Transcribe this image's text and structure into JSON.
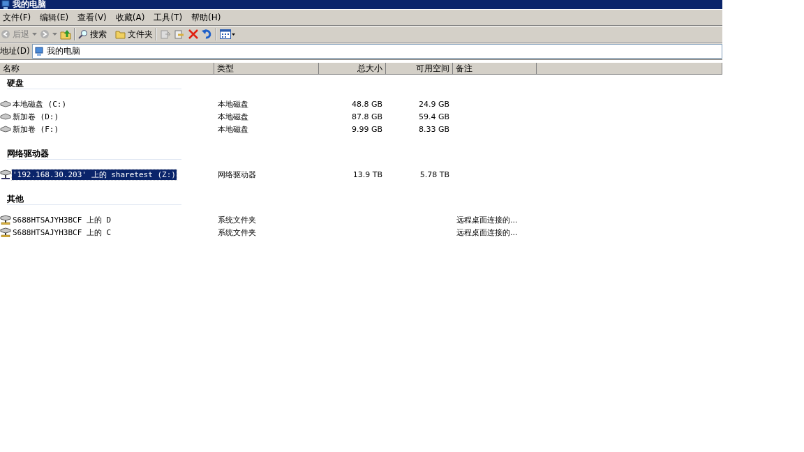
{
  "window": {
    "title": "我的电脑"
  },
  "menu": [
    "文件(F)",
    "编辑(E)",
    "查看(V)",
    "收藏(A)",
    "工具(T)",
    "帮助(H)"
  ],
  "toolbar": {
    "back": {
      "label": "后退",
      "disabled": true
    },
    "forward": {
      "disabled": true
    },
    "search": "搜索",
    "folders": "文件夹"
  },
  "address": {
    "label": "地址(D)",
    "value": "我的电脑"
  },
  "columns": [
    "名称",
    "类型",
    "总大小",
    "可用空间",
    "备注"
  ],
  "groups": [
    {
      "title": "硬盘",
      "items": [
        {
          "kind": "disk",
          "name": "本地磁盘 (C:)",
          "type": "本地磁盘",
          "total": "48.8 GB",
          "free": "24.9 GB",
          "selected": false
        },
        {
          "kind": "disk",
          "name": "新加卷 (D:)",
          "type": "本地磁盘",
          "total": "87.8 GB",
          "free": "59.4 GB",
          "selected": false
        },
        {
          "kind": "disk",
          "name": "新加卷 (F:)",
          "type": "本地磁盘",
          "total": "9.99 GB",
          "free": "8.33 GB",
          "selected": false
        }
      ]
    },
    {
      "title": "网络驱动器",
      "items": [
        {
          "kind": "network",
          "name": "'192.168.30.203' 上的 sharetest (Z:)",
          "type": "网络驱动器",
          "total": "13.9 TB",
          "free": "5.78 TB",
          "selected": true
        }
      ]
    },
    {
      "title": "其他",
      "items": [
        {
          "kind": "share",
          "name": "S688HTSAJYH3BCF 上的 D",
          "type": "系统文件夹",
          "comment": "远程桌面连接的...",
          "selected": false
        },
        {
          "kind": "share",
          "name": "S688HTSAJYH3BCF 上的 C",
          "type": "系统文件夹",
          "comment": "远程桌面连接的...",
          "selected": false
        }
      ]
    }
  ]
}
